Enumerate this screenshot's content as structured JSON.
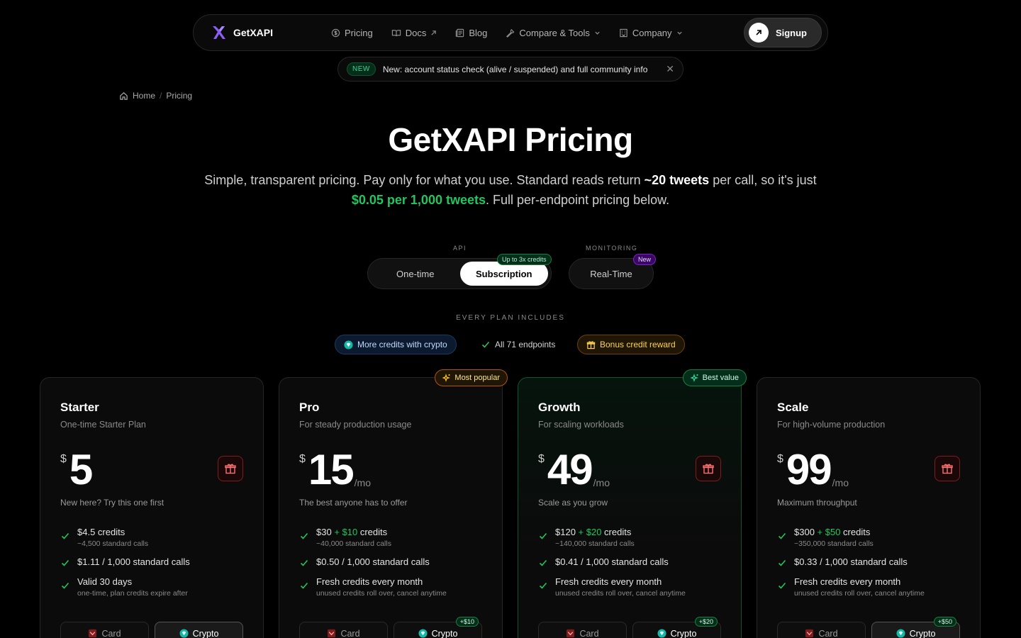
{
  "nav": {
    "brand": "GetXAPI",
    "items": [
      {
        "label": "Pricing"
      },
      {
        "label": "Docs"
      },
      {
        "label": "Blog"
      },
      {
        "label": "Compare & Tools"
      },
      {
        "label": "Company"
      }
    ],
    "signup": "Signup"
  },
  "banner": {
    "pill": "NEW",
    "text": "New: account status check (alive / suspended) and full community info"
  },
  "breadcrumb": {
    "home": "Home",
    "sep": "/",
    "current": "Pricing"
  },
  "hero": {
    "title": "GetXAPI Pricing",
    "sub1": "Simple, transparent pricing. Pay only for what you use. Standard reads return ",
    "sub_bold": "~20 tweets",
    "sub2": " per call, so it's just ",
    "sub_green": "$0.05 per 1,000 tweets",
    "sub3": ". Full per-endpoint pricing below."
  },
  "toggles": {
    "api_label": "API",
    "monitoring_label": "MONITORING",
    "one_time": "One-time",
    "subscription": "Subscription",
    "subscription_badge": "Up to 3x credits",
    "realtime": "Real-Time",
    "realtime_badge": "New"
  },
  "includes": {
    "label": "EVERY PLAN INCLUDES",
    "crypto": "More credits with crypto",
    "endpoints": "All 71 endpoints",
    "bonus": "Bonus credit reward"
  },
  "plans": [
    {
      "name": "Starter",
      "desc": "One-time Starter Plan",
      "currency": "$",
      "amount": "5",
      "per": "",
      "tagline": "New here? Try this one first",
      "f1_main": "$4.5 credits",
      "f1_plus": "",
      "f1_end": "",
      "f1_sub": "~4,500 standard calls",
      "f2_main": "$1.11 / 1,000 standard calls",
      "f3_main": "Valid 30 days",
      "f3_sub": "one-time, plan credits expire after",
      "card": "Card",
      "crypto": "Crypto",
      "crypto_plus": ""
    },
    {
      "name": "Pro",
      "desc": "For steady production usage",
      "currency": "$",
      "amount": "15",
      "per": "/mo",
      "badge": "Most popular",
      "tagline": "The best anyone has to offer",
      "f1_main": "$30",
      "f1_plus": " + $10",
      "f1_end": " credits",
      "f1_sub": "~40,000 standard calls",
      "f2_main": "$0.50 / 1,000 standard calls",
      "f3_main": "Fresh credits every month",
      "f3_sub": "unused credits roll over, cancel anytime",
      "card": "Card",
      "crypto": "Crypto",
      "crypto_plus": "+$10"
    },
    {
      "name": "Growth",
      "desc": "For scaling workloads",
      "currency": "$",
      "amount": "49",
      "per": "/mo",
      "badge": "Best value",
      "tagline": "Scale as you grow",
      "f1_main": "$120",
      "f1_plus": " + $20",
      "f1_end": " credits",
      "f1_sub": "~140,000 standard calls",
      "f2_main": "$0.41 / 1,000 standard calls",
      "f3_main": "Fresh credits every month",
      "f3_sub": "unused credits roll over, cancel anytime",
      "card": "Card",
      "crypto": "Crypto",
      "crypto_plus": "+$20"
    },
    {
      "name": "Scale",
      "desc": "For high-volume production",
      "currency": "$",
      "amount": "99",
      "per": "/mo",
      "tagline": "Maximum throughput",
      "f1_main": "$300",
      "f1_plus": " + $50",
      "f1_end": " credits",
      "f1_sub": "~350,000 standard calls",
      "f2_main": "$0.33 / 1,000 standard calls",
      "f3_main": "Fresh credits every month",
      "f3_sub": "unused credits roll over, cancel anytime",
      "card": "Card",
      "crypto": "Crypto",
      "crypto_plus": "+$50"
    }
  ],
  "colors": {
    "accent_green": "#22c55e",
    "gold": "#fcd34d",
    "brand_purple": "#8b5cf6"
  }
}
